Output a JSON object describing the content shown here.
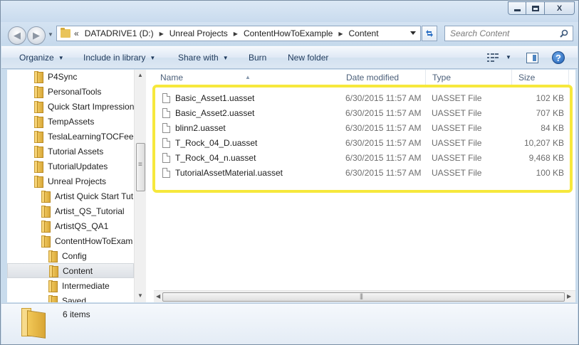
{
  "window": {
    "minimize_label": "",
    "maximize_label": "",
    "close_label": "X"
  },
  "address": {
    "lead": "«",
    "crumbs": [
      "DATADRIVE1 (D:)",
      "Unreal Projects",
      "ContentHowToExample",
      "Content"
    ]
  },
  "search": {
    "placeholder": "Search Content"
  },
  "toolbar": {
    "organize": "Organize",
    "include_in_library": "Include in library",
    "share_with": "Share with",
    "burn": "Burn",
    "new_folder": "New folder",
    "help_label": "?"
  },
  "nav_tree": [
    {
      "label": "P4Sync",
      "indent": 0,
      "selected": false
    },
    {
      "label": "PersonalTools",
      "indent": 0,
      "selected": false
    },
    {
      "label": "Quick Start Impression",
      "indent": 0,
      "selected": false
    },
    {
      "label": "TempAssets",
      "indent": 0,
      "selected": false
    },
    {
      "label": "TeslaLearningTOCFeed",
      "indent": 0,
      "selected": false
    },
    {
      "label": "Tutorial Assets",
      "indent": 0,
      "selected": false
    },
    {
      "label": "TutorialUpdates",
      "indent": 0,
      "selected": false
    },
    {
      "label": "Unreal Projects",
      "indent": 0,
      "selected": false
    },
    {
      "label": "Artist Quick Start Tut",
      "indent": 1,
      "selected": false
    },
    {
      "label": "Artist_QS_Tutorial",
      "indent": 1,
      "selected": false
    },
    {
      "label": "ArtistQS_QA1",
      "indent": 1,
      "selected": false
    },
    {
      "label": "ContentHowToExam",
      "indent": 1,
      "selected": false
    },
    {
      "label": "Config",
      "indent": 2,
      "selected": false
    },
    {
      "label": "Content",
      "indent": 2,
      "selected": true
    },
    {
      "label": "Intermediate",
      "indent": 2,
      "selected": false
    },
    {
      "label": "Saved",
      "indent": 2,
      "selected": false
    }
  ],
  "columns": {
    "name": "Name",
    "date_modified": "Date modified",
    "type": "Type",
    "size": "Size"
  },
  "files": [
    {
      "name": "Basic_Asset1.uasset",
      "date": "6/30/2015 11:57 AM",
      "type": "UASSET File",
      "size": "102 KB"
    },
    {
      "name": "Basic_Asset2.uasset",
      "date": "6/30/2015 11:57 AM",
      "type": "UASSET File",
      "size": "707 KB"
    },
    {
      "name": "blinn2.uasset",
      "date": "6/30/2015 11:57 AM",
      "type": "UASSET File",
      "size": "84 KB"
    },
    {
      "name": "T_Rock_04_D.uasset",
      "date": "6/30/2015 11:57 AM",
      "type": "UASSET File",
      "size": "10,207 KB"
    },
    {
      "name": "T_Rock_04_n.uasset",
      "date": "6/30/2015 11:57 AM",
      "type": "UASSET File",
      "size": "9,468 KB"
    },
    {
      "name": "TutorialAssetMaterial.uasset",
      "date": "6/30/2015 11:57 AM",
      "type": "UASSET File",
      "size": "100 KB"
    }
  ],
  "status": {
    "item_count": "6 items"
  },
  "colors": {
    "highlight": "#f6e83c",
    "accent": "#1e395b"
  }
}
